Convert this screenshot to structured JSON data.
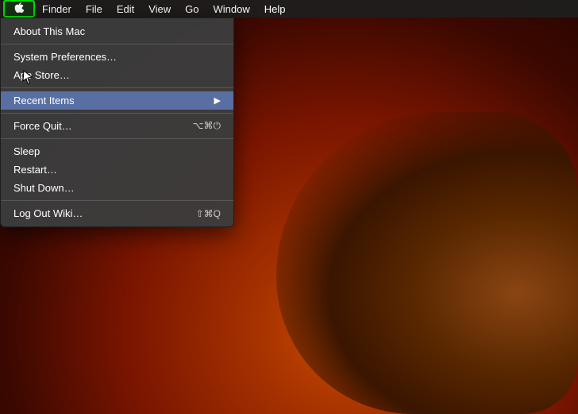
{
  "menubar": {
    "apple_label": "",
    "items": [
      {
        "id": "finder",
        "label": "Finder"
      },
      {
        "id": "file",
        "label": "File"
      },
      {
        "id": "edit",
        "label": "Edit"
      },
      {
        "id": "view",
        "label": "View"
      },
      {
        "id": "go",
        "label": "Go"
      },
      {
        "id": "window",
        "label": "Window"
      },
      {
        "id": "help",
        "label": "Help"
      }
    ]
  },
  "apple_menu": {
    "items": [
      {
        "id": "about",
        "label": "About This Mac",
        "shortcut": "",
        "has_arrow": false,
        "separator_after": false
      },
      {
        "id": "sep1",
        "separator": true
      },
      {
        "id": "system_prefs",
        "label": "System Preferences…",
        "shortcut": "",
        "has_arrow": false,
        "separator_after": false
      },
      {
        "id": "app_store",
        "label": "App Store…",
        "shortcut": "",
        "has_arrow": false,
        "separator_after": false
      },
      {
        "id": "sep2",
        "separator": true
      },
      {
        "id": "recent_items",
        "label": "Recent Items",
        "shortcut": "",
        "has_arrow": true,
        "separator_after": false,
        "highlighted": true
      },
      {
        "id": "sep3",
        "separator": true
      },
      {
        "id": "force_quit",
        "label": "Force Quit…",
        "shortcut": "⌥⌘⏻",
        "has_arrow": false,
        "separator_after": false
      },
      {
        "id": "sep4",
        "separator": true
      },
      {
        "id": "sleep",
        "label": "Sleep",
        "shortcut": "",
        "has_arrow": false,
        "separator_after": false
      },
      {
        "id": "restart",
        "label": "Restart…",
        "shortcut": "",
        "has_arrow": false,
        "separator_after": false
      },
      {
        "id": "shut_down",
        "label": "Shut Down…",
        "shortcut": "",
        "has_arrow": false,
        "separator_after": false
      },
      {
        "id": "sep5",
        "separator": true
      },
      {
        "id": "logout",
        "label": "Log Out Wiki…",
        "shortcut": "⇧⌘Q",
        "has_arrow": false,
        "separator_after": false
      }
    ]
  },
  "icons": {
    "apple": "🍎",
    "arrow_right": "▶"
  }
}
